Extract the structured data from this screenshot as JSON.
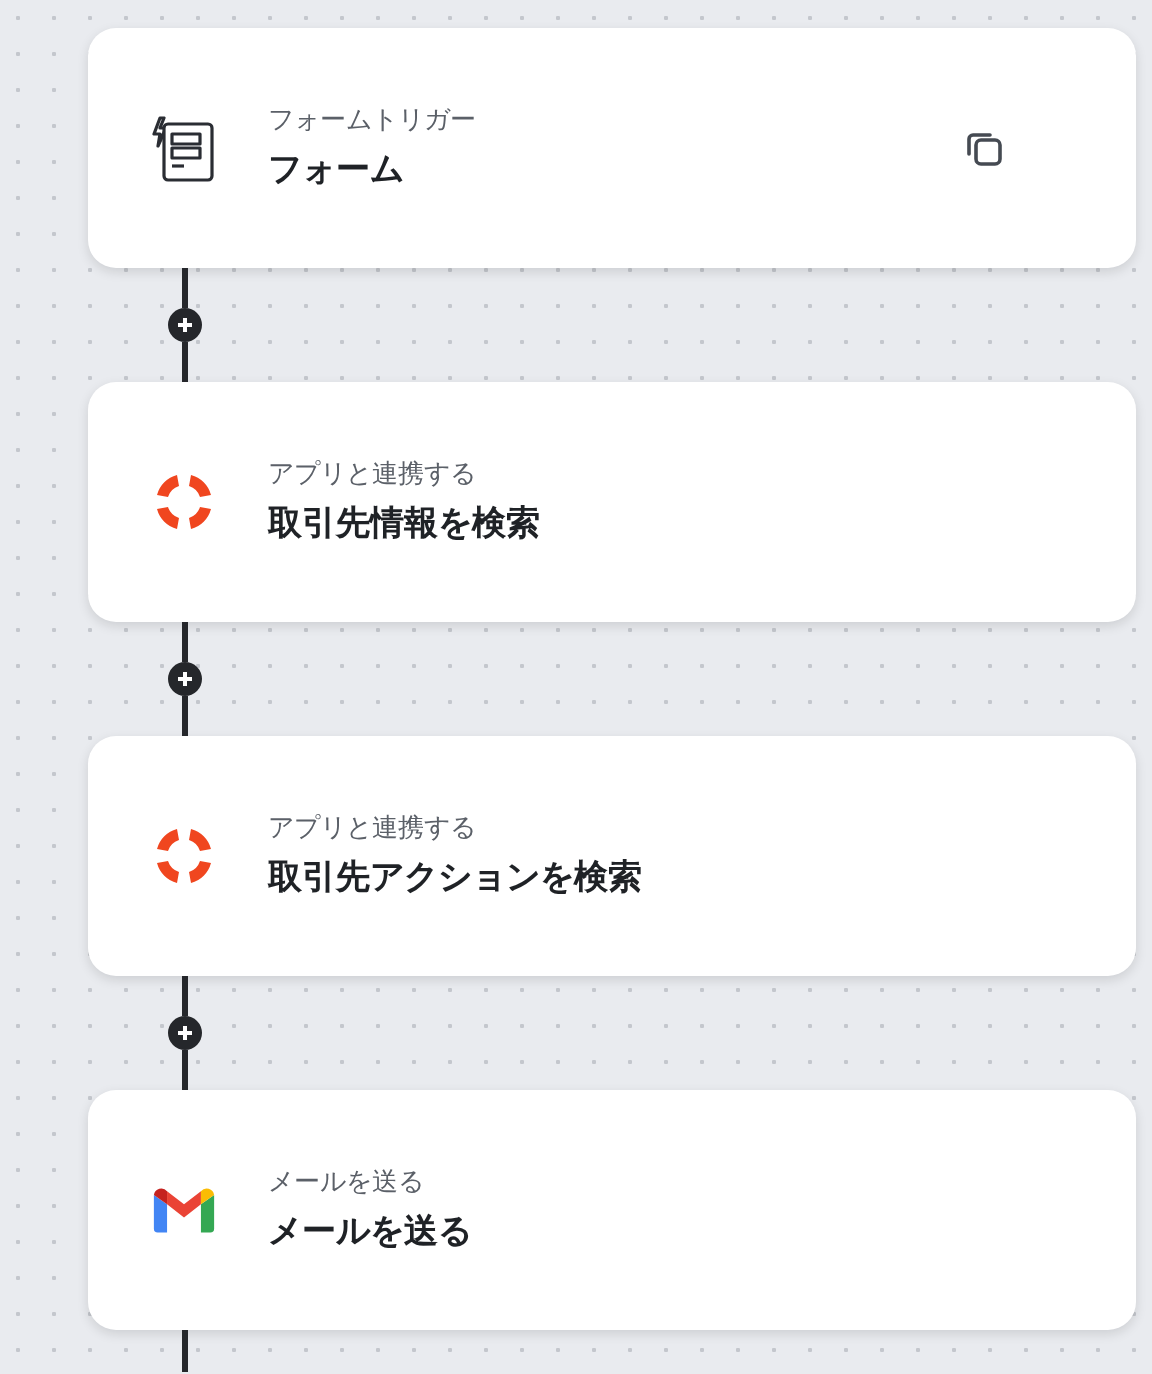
{
  "steps": [
    {
      "kind": "form",
      "label": "フォームトリガー",
      "title": "フォーム",
      "copyable": true
    },
    {
      "kind": "crm",
      "label": "アプリと連携する",
      "title": "取引先情報を検索",
      "copyable": false
    },
    {
      "kind": "crm",
      "label": "アプリと連携する",
      "title": "取引先アクションを検索",
      "copyable": false
    },
    {
      "kind": "gmail",
      "label": "メールを送る",
      "title": "メールを送る",
      "copyable": false
    }
  ]
}
